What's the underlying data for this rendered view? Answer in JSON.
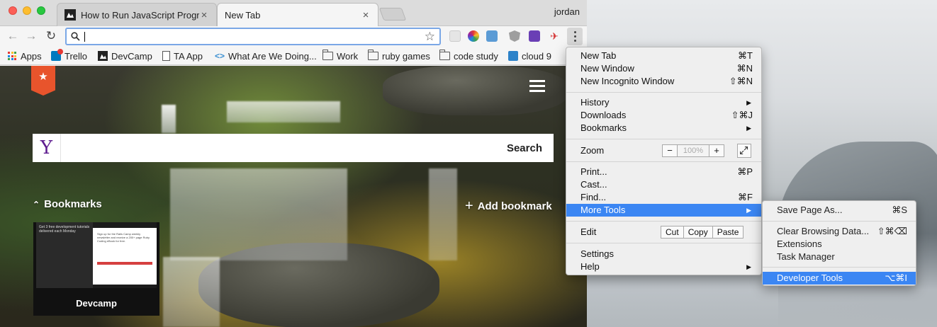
{
  "user": "jordan",
  "tabs": [
    {
      "title": "How to Run JavaScript Programs"
    },
    {
      "title": "New Tab"
    }
  ],
  "toolbar": {
    "address_value": ""
  },
  "bookmarks_bar": [
    {
      "label": "Apps",
      "icon": "apps-grid-icon"
    },
    {
      "label": "Trello",
      "icon": "trello-icon"
    },
    {
      "label": "DevCamp",
      "icon": "devcamp-icon"
    },
    {
      "label": "TA App",
      "icon": "page-icon"
    },
    {
      "label": "What Are We Doing...",
      "icon": "code-icon"
    },
    {
      "label": "Work",
      "icon": "folder-icon"
    },
    {
      "label": "ruby games",
      "icon": "folder-icon"
    },
    {
      "label": "code study",
      "icon": "folder-icon"
    },
    {
      "label": "cloud 9",
      "icon": "cloud9-icon"
    }
  ],
  "newtab": {
    "search_button": "Search",
    "bookmarks_heading": "Bookmarks",
    "add_bookmark": "Add bookmark",
    "tile_label": "Devcamp",
    "tile_thumb_text": "Get 3 free development tutorials delivered each Monday",
    "tile_form_text": "Sign up for the Rails Camp weekly newsletter and receive a 200+ page Ruby Coding eBook for free."
  },
  "menu": {
    "items": [
      {
        "label": "New Tab",
        "shortcut": "⌘T"
      },
      {
        "label": "New Window",
        "shortcut": "⌘N"
      },
      {
        "label": "New Incognito Window",
        "shortcut": "⇧⌘N"
      },
      {
        "label": "History",
        "shortcut": "▶"
      },
      {
        "label": "Downloads",
        "shortcut": "⇧⌘J"
      },
      {
        "label": "Bookmarks",
        "shortcut": "▶"
      },
      {
        "label": "Zoom",
        "zoom_value": "100%"
      },
      {
        "label": "Print...",
        "shortcut": "⌘P"
      },
      {
        "label": "Cast...",
        "shortcut": ""
      },
      {
        "label": "Find...",
        "shortcut": "⌘F"
      },
      {
        "label": "More Tools",
        "shortcut": "▶"
      },
      {
        "label": "Edit",
        "cut": "Cut",
        "copy": "Copy",
        "paste": "Paste"
      },
      {
        "label": "Settings",
        "shortcut": ""
      },
      {
        "label": "Help",
        "shortcut": "▶"
      }
    ]
  },
  "submenu": {
    "items": [
      {
        "label": "Save Page As...",
        "shortcut": "⌘S"
      },
      {
        "label": "Clear Browsing Data...",
        "shortcut": "⇧⌘⌫"
      },
      {
        "label": "Extensions",
        "shortcut": ""
      },
      {
        "label": "Task Manager",
        "shortcut": ""
      },
      {
        "label": "Developer Tools",
        "shortcut": "⌥⌘I"
      }
    ]
  },
  "colors": {
    "highlight": "#3b86f3",
    "ribbon": "#e8542c",
    "yahoo": "#5f1d90"
  }
}
